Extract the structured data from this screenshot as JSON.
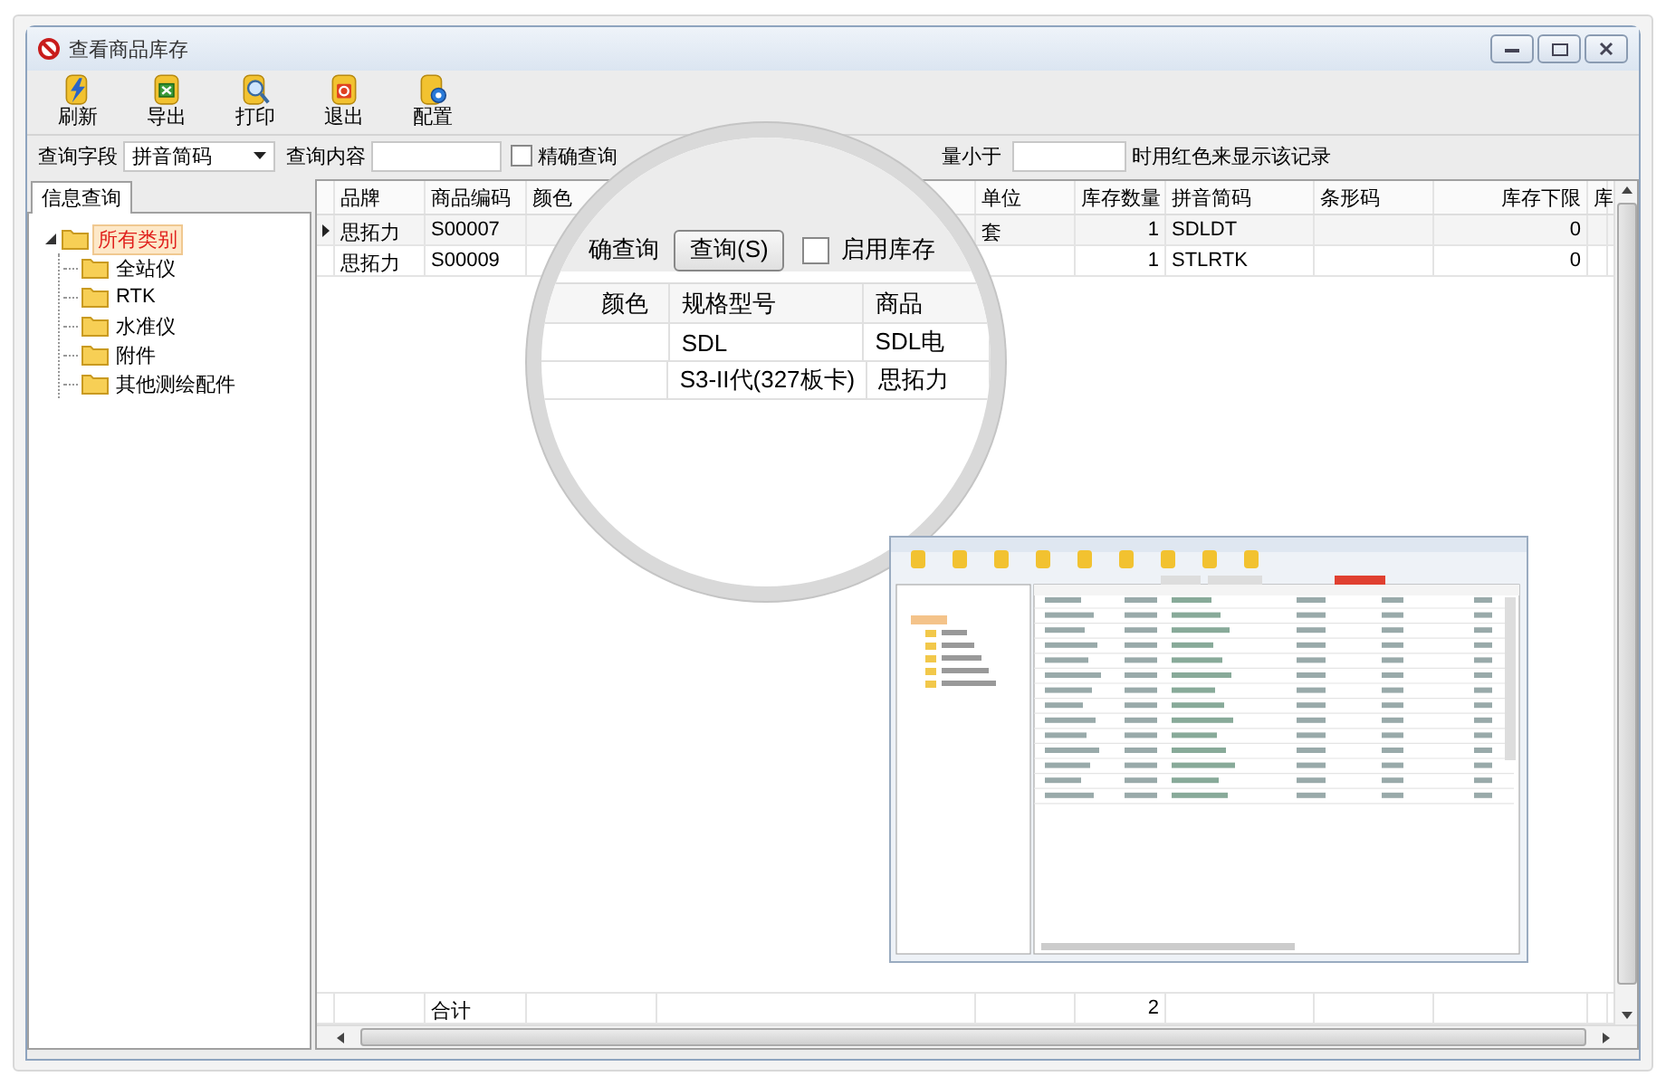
{
  "window": {
    "title": "查看商品库存"
  },
  "toolbar": [
    {
      "label": "刷新"
    },
    {
      "label": "导出"
    },
    {
      "label": "打印"
    },
    {
      "label": "退出"
    },
    {
      "label": "配置"
    }
  ],
  "filter": {
    "field_label": "查询字段",
    "field_value": "拼音简码",
    "content_label": "查询内容",
    "exact_match": {
      "label": "精确查询",
      "checked": false
    },
    "threshold_label": "量小于",
    "threshold_suffix": "时用红色来显示该记录"
  },
  "sidebar": {
    "tab": "信息查询",
    "tree": [
      {
        "label": "所有类别",
        "expanded": true,
        "selected": true,
        "children": [
          {
            "label": "全站仪",
            "selected": false
          },
          {
            "label": "RTK",
            "selected": false
          },
          {
            "label": "水准仪",
            "selected": false
          },
          {
            "label": "附件",
            "selected": false
          },
          {
            "label": "其他测绘配件",
            "selected": false
          }
        ]
      }
    ]
  },
  "table": {
    "columns": [
      "品牌",
      "商品编码",
      "颜色",
      "单位",
      "库存数量",
      "拼音简码",
      "条形码",
      "库存下限",
      "库"
    ],
    "rows": [
      {
        "selected": true,
        "brand": "思拓力",
        "code": "S00007",
        "unit": "套",
        "qty": "1",
        "pinyin": "SDLDT",
        "min_stock": "0"
      },
      {
        "selected": false,
        "brand": "思拓力",
        "code": "S00009",
        "qty": "1",
        "pinyin": "STLRTK",
        "min_stock": "0"
      }
    ],
    "footer": {
      "label": "合计",
      "total": "2"
    }
  },
  "magnifier": {
    "exact_label_part": "确查询",
    "search_button": "查询(S)",
    "alarm_checkbox": {
      "label": "启用库存",
      "checked": false
    },
    "columns": [
      "颜色",
      "规格型号",
      "商品"
    ],
    "rows": [
      {
        "spec": "SDL",
        "name": "SDL电"
      },
      {
        "spec": "S3-II代(327板卡)",
        "name": "思拓力"
      }
    ]
  }
}
